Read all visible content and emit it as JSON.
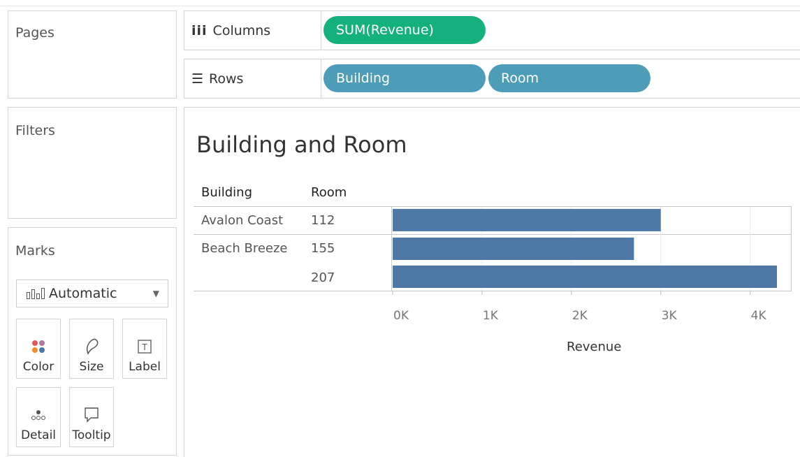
{
  "panels": {
    "pages_title": "Pages",
    "filters_title": "Filters",
    "marks_title": "Marks"
  },
  "marks": {
    "type_selected": "Automatic",
    "buttons": [
      "Color",
      "Size",
      "Label",
      "Detail",
      "Tooltip"
    ]
  },
  "shelves": {
    "columns_label": "Columns",
    "rows_label": "Rows",
    "columns_pills": [
      "SUM(Revenue)"
    ],
    "rows_pills": [
      "Building",
      "Room"
    ]
  },
  "colors": {
    "measure_pill": "#14b07d",
    "dimension_pill": "#4d9cb8",
    "bar": "#4e79a7"
  },
  "sheet": {
    "title": "Building and Room",
    "header_building": "Building",
    "header_room": "Room"
  },
  "chart_data": {
    "type": "bar",
    "orientation": "horizontal",
    "rows": [
      {
        "building": "Avalon Coast",
        "room": "112",
        "value": 3000
      },
      {
        "building": "Beach Breeze",
        "room": "155",
        "value": 2700
      },
      {
        "building": "",
        "room": "207",
        "value": 4300
      }
    ],
    "xlabel": "Revenue",
    "xlim": [
      0,
      4300
    ],
    "xticks": [
      {
        "value": 0,
        "label": "0K"
      },
      {
        "value": 1000,
        "label": "1K"
      },
      {
        "value": 2000,
        "label": "2K"
      },
      {
        "value": 3000,
        "label": "3K"
      },
      {
        "value": 4000,
        "label": "4K"
      }
    ],
    "grid": true
  }
}
